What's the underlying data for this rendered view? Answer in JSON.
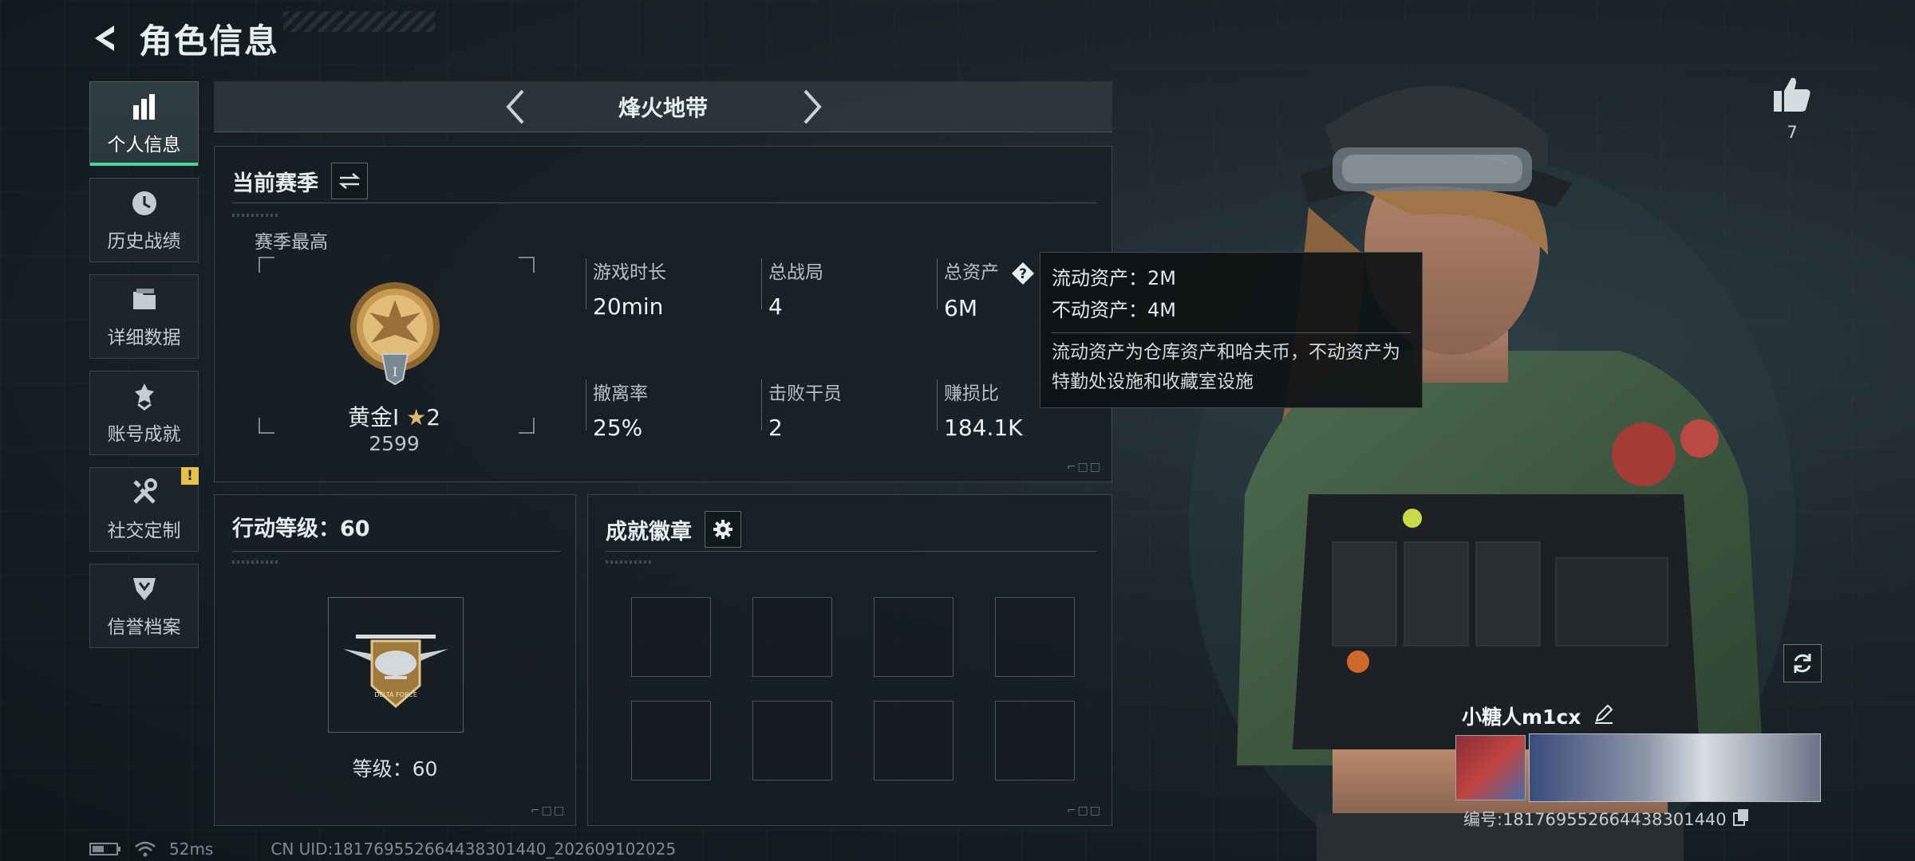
{
  "header": {
    "title": "角色信息"
  },
  "sidebar": {
    "items": [
      {
        "label": "个人信息",
        "icon": "bar-chart-icon",
        "active": true
      },
      {
        "label": "历史战绩",
        "icon": "clock-icon"
      },
      {
        "label": "详细数据",
        "icon": "folder-icon"
      },
      {
        "label": "账号成就",
        "icon": "medal-icon"
      },
      {
        "label": "社交定制",
        "icon": "tools-icon",
        "badge": "!"
      },
      {
        "label": "信誉档案",
        "icon": "shield-icon"
      }
    ]
  },
  "mode": {
    "title": "烽火地带"
  },
  "season": {
    "title": "当前赛季",
    "best_label": "赛季最高",
    "rank_name": "黄金I",
    "rank_stars": "2",
    "rank_score": "2599",
    "stats": [
      {
        "label": "游戏时长",
        "value": "20min"
      },
      {
        "label": "总战局",
        "value": "4"
      },
      {
        "label": "总资产",
        "value": "6M"
      },
      {
        "label": "撤离率",
        "value": "25%"
      },
      {
        "label": "击败干员",
        "value": "2"
      },
      {
        "label": "赚损比",
        "value": "184.1K"
      }
    ]
  },
  "tooltip": {
    "line1": "流动资产：2M",
    "line2": "不动资产：4M",
    "desc": "流动资产为仓库资产和哈夫币，不动资产为特勤处设施和收藏室设施"
  },
  "level": {
    "title": "行动等级：60",
    "text": "等级：60"
  },
  "achievements": {
    "title": "成就徽章",
    "slots": 8
  },
  "player": {
    "likes": "7",
    "name": "小糖人m1cx",
    "id": "编号:1817695526644383014​40"
  },
  "footer": {
    "ping": "52ms",
    "uid": "CN UID:1817695526644383014​40_202609102025"
  },
  "colors": {
    "accent": "#4bd69a",
    "badge": "#e7c24a"
  }
}
